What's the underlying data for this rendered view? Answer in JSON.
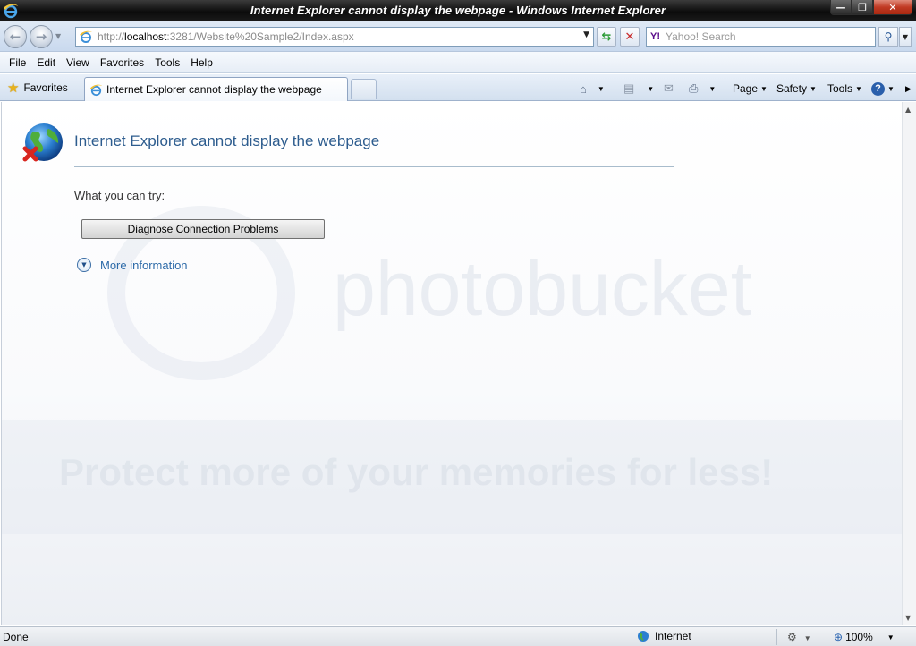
{
  "window": {
    "title": "Internet Explorer cannot display the webpage - Windows Internet Explorer"
  },
  "address_bar": {
    "url_prefix": "http://",
    "url_host": "localhost",
    "url_rest": ":3281/Website%20Sample2/Index.aspx"
  },
  "search": {
    "provider_logo": "Y!",
    "placeholder": "Yahoo! Search"
  },
  "menu": {
    "items": [
      "File",
      "Edit",
      "View",
      "Favorites",
      "Tools",
      "Help"
    ]
  },
  "tabs": {
    "favorites_label": "Favorites",
    "active_tab_label": "Internet Explorer cannot display the webpage"
  },
  "command_bar": {
    "page_label": "Page",
    "safety_label": "Safety",
    "tools_label": "Tools"
  },
  "content": {
    "heading": "Internet Explorer cannot display the webpage",
    "try_label": "What you can try:",
    "diagnose_button": "Diagnose Connection Problems",
    "more_info_link": "More information"
  },
  "watermark": {
    "logo_text": "photobucket",
    "tagline": "Protect more of your memories for less!"
  },
  "status_bar": {
    "status_text": "Done",
    "zone_label": "Internet",
    "zoom_level": "100%"
  },
  "colors": {
    "heading_blue": "#2d5c8e",
    "link_blue": "#2d6aa8",
    "titlebar_dark": "#0c0c0c"
  }
}
